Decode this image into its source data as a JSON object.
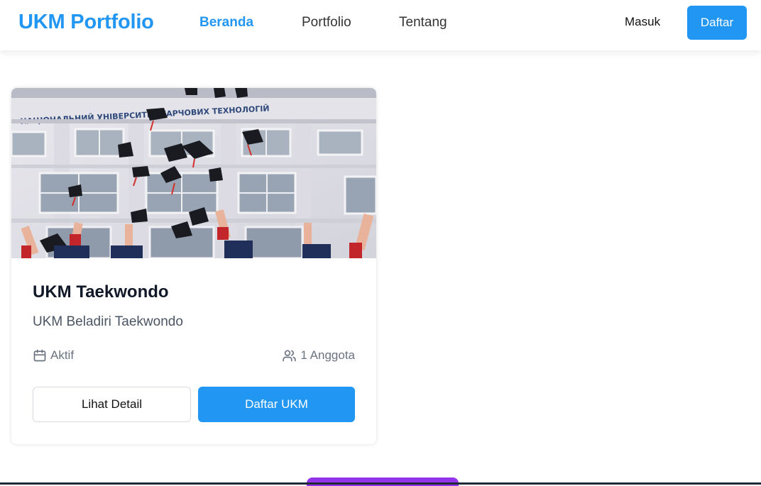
{
  "navbar": {
    "brand": "UKM Portfolio",
    "links": [
      {
        "label": "Beranda",
        "active": true
      },
      {
        "label": "Portfolio",
        "active": false
      },
      {
        "label": "Tentang",
        "active": false
      }
    ],
    "login_label": "Masuk",
    "register_label": "Daftar"
  },
  "card": {
    "title": "UKM Taekwondo",
    "subtitle": "UKM Beladiri Taekwondo",
    "status": "Aktif",
    "members": "1 Anggota",
    "detail_button": "Lihat Detail",
    "join_button": "Daftar UKM",
    "image_sign_text": "НАЦІОНАЛЬНИЙ УНІВЕРСИТЕТ ХАРЧОВИХ ТЕХНОЛОГІЙ",
    "status_icon": "calendar-icon",
    "members_icon": "users-icon"
  },
  "colors": {
    "primary": "#2196f3",
    "bottom_accent": "#9333ea"
  }
}
